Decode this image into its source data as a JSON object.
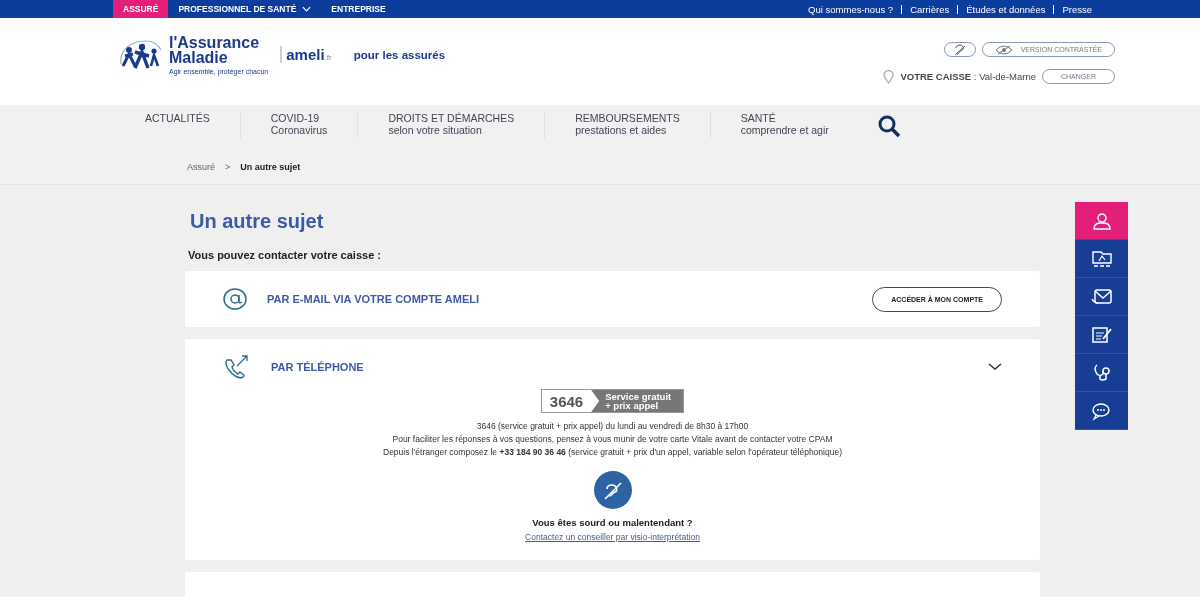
{
  "top_bar": {
    "audiences": [
      {
        "label": "ASSURÉ",
        "selected": true,
        "has_menu": false
      },
      {
        "label": "PROFESSIONNEL DE SANTÉ",
        "selected": false,
        "has_menu": true
      },
      {
        "label": "ENTREPRISE",
        "selected": false,
        "has_menu": false
      }
    ],
    "links": [
      "Qui sommes-nous ?",
      "Carrières",
      "Études et données",
      "Presse"
    ]
  },
  "header": {
    "logo": {
      "line1": "l'Assurance",
      "line2": "Maladie",
      "tagline": "Agir ensemble, protéger chacun"
    },
    "site": {
      "name": "ameli",
      "tld": ".fr",
      "audience": "pour les assurés"
    },
    "contrast_button": "VERSION CONTRASTÉE",
    "caisse": {
      "text": "**VOTRE CAISSE** : Val-de-Marne",
      "button": "CHANGER"
    }
  },
  "nav": [
    {
      "title": "ACTUALITÉS"
    },
    {
      "title": "COVID-19",
      "subtitle": "Coronavirus"
    },
    {
      "title": "DROITS ET DÉMARCHES",
      "subtitle": "selon votre situation"
    },
    {
      "title": "REMBOURSEMENTS",
      "subtitle": "prestations et aides"
    },
    {
      "title": "SANTÉ",
      "subtitle": "comprendre et agir"
    }
  ],
  "breadcrumb": {
    "items": [
      "Assuré",
      "Un autre sujet"
    ],
    "separator": ">"
  },
  "main": {
    "title": "Un autre sujet",
    "intro": "Vous pouvez contacter votre caisse :",
    "sections": [
      {
        "kind": "email",
        "title": "PAR E-MAIL VIA VOTRE COMPTE AMELI",
        "button": "ACCÉDER À MON COMPTE"
      },
      {
        "kind": "phone",
        "title": "PAR TÉLÉPHONE",
        "badge": {
          "number": "3646",
          "note": [
            "Service gratuit",
            "+ prix appel"
          ]
        },
        "lines": [
          "3646 (service gratuit + prix appel) du lundi au vendredi de 8h30 à 17h00",
          "Pour faciliter les réponses à vos questions, pensez à vous munir de votre carte Vitale avant de contacter votre CPAM",
          "Depuis l'étranger composez le **+33 184 90 36 46** (service gratuit + prix d'un appel, variable selon l'opérateur téléphonique)"
        ],
        "deaf_question": "Vous êtes sourd ou malentendant ?",
        "deaf_link": "Contactez un conseiller par visio-interprétation"
      }
    ]
  },
  "side_tabs": [
    {
      "kind": "person",
      "selected": true
    },
    {
      "kind": "dmp",
      "selected": false
    },
    {
      "kind": "mail",
      "selected": false
    },
    {
      "kind": "form",
      "selected": false
    },
    {
      "kind": "stethoscope",
      "selected": false
    },
    {
      "kind": "chat",
      "selected": false
    }
  ]
}
